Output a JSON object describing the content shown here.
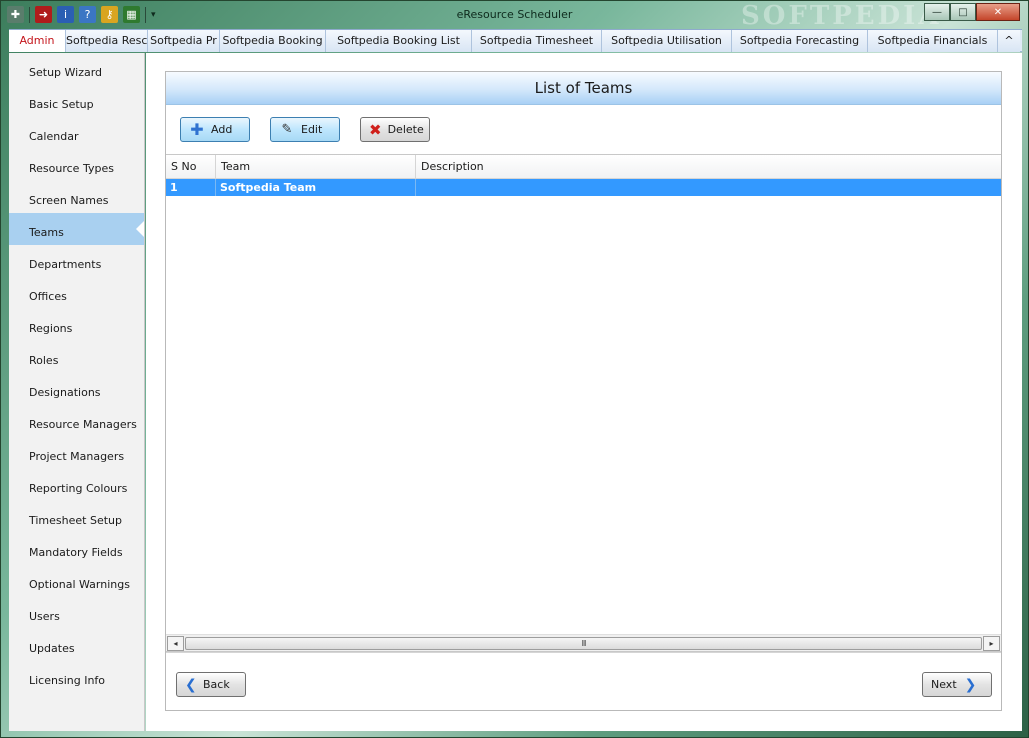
{
  "window": {
    "title": "eResource Scheduler",
    "watermark": "SOFTPEDIA",
    "controls": {
      "minimize": "—",
      "maximize": "□",
      "close": "✕"
    },
    "quick_access": [
      "pin-icon",
      "exit-icon",
      "info-icon",
      "help-icon",
      "key-icon",
      "chart-icon"
    ]
  },
  "tabs": [
    {
      "label": "Admin",
      "active": true
    },
    {
      "label": "Softpedia Resc"
    },
    {
      "label": "Softpedia Pr"
    },
    {
      "label": "Softpedia Booking"
    },
    {
      "label": "Softpedia Booking List"
    },
    {
      "label": "Softpedia Timesheet"
    },
    {
      "label": "Softpedia Utilisation"
    },
    {
      "label": "Softpedia Forecasting"
    },
    {
      "label": "Softpedia Financials"
    }
  ],
  "tab_scroll": "^",
  "sidebar": {
    "items": [
      {
        "label": "Setup Wizard"
      },
      {
        "label": "Basic Setup"
      },
      {
        "label": "Calendar"
      },
      {
        "label": "Resource Types"
      },
      {
        "label": "Screen Names"
      },
      {
        "label": "Teams",
        "active": true
      },
      {
        "label": "Departments"
      },
      {
        "label": "Offices"
      },
      {
        "label": "Regions"
      },
      {
        "label": "Roles"
      },
      {
        "label": "Designations"
      },
      {
        "label": "Resource Managers"
      },
      {
        "label": "Project Managers"
      },
      {
        "label": "Reporting Colours"
      },
      {
        "label": "Timesheet Setup"
      },
      {
        "label": "Mandatory Fields"
      },
      {
        "label": "Optional Warnings"
      },
      {
        "label": "Users"
      },
      {
        "label": "Updates"
      },
      {
        "label": "Licensing Info"
      }
    ]
  },
  "panel": {
    "title": "List of Teams",
    "toolbar": {
      "add": "Add",
      "edit": "Edit",
      "delete": "Delete"
    },
    "grid": {
      "columns": [
        "S No",
        "Team",
        "Description"
      ],
      "rows": [
        {
          "sno": "1",
          "team": "Softpedia Team",
          "description": "",
          "selected": true
        }
      ]
    },
    "scroll": {
      "left": "◂",
      "right": "▸",
      "thumb": "III"
    },
    "nav": {
      "back": "Back",
      "next": "Next"
    }
  },
  "colors": {
    "selected_row": "#3399ff",
    "active_tab_text": "#c4161c",
    "active_sidebar": "#a9d0f0",
    "header_gradient_end": "#a8d0f5"
  }
}
